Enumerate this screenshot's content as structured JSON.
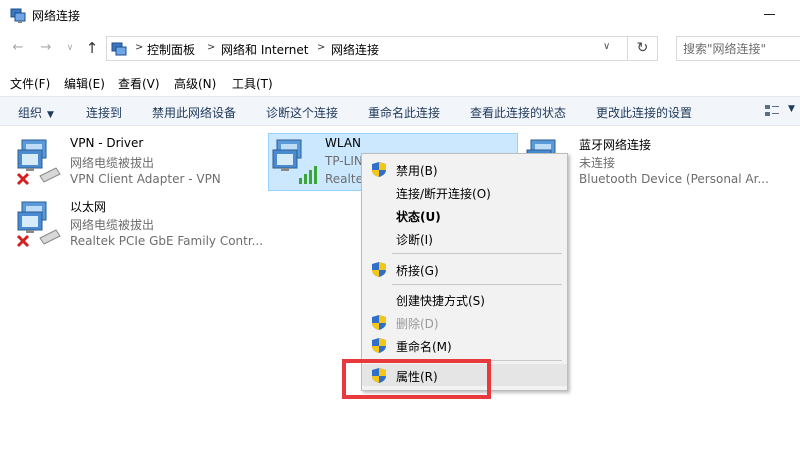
{
  "window": {
    "title": "网络连接"
  },
  "address": {
    "crumbs": [
      "控制面板",
      "网络和 Internet",
      "网络连接"
    ],
    "search_placeholder": "搜索\"网络连接\""
  },
  "menubar": {
    "items": [
      "文件(F)",
      "编辑(E)",
      "查看(V)",
      "高级(N)",
      "工具(T)"
    ]
  },
  "commandbar": {
    "organize": "组织",
    "items": [
      "连接到",
      "禁用此网络设备",
      "诊断这个连接",
      "重命名此连接",
      "查看此连接的状态",
      "更改此连接的设置"
    ]
  },
  "connections": [
    {
      "name": "VPN - Driver",
      "status": "网络电缆被拔出",
      "device": "VPN Client Adapter - VPN",
      "icon": "wired-disconnected"
    },
    {
      "name": "WLAN",
      "status": "TP-LIN",
      "device": "Realte",
      "icon": "wireless-connected"
    },
    {
      "name": "蓝牙网络连接",
      "status": "未连接",
      "device": "Bluetooth Device (Personal Ar...",
      "icon": "bluetooth"
    },
    {
      "name": "以太网",
      "status": "网络电缆被拔出",
      "device": "Realtek PCIe GbE Family Contr...",
      "icon": "wired-disconnected"
    }
  ],
  "context_menu": {
    "items": [
      {
        "label": "禁用(B)",
        "shield": true,
        "bold": false,
        "disabled": false
      },
      {
        "label": "连接/断开连接(O)",
        "shield": false,
        "bold": false,
        "disabled": false
      },
      {
        "label": "状态(U)",
        "shield": false,
        "bold": true,
        "disabled": false
      },
      {
        "label": "诊断(I)",
        "shield": false,
        "bold": false,
        "disabled": false
      },
      {
        "label": "桥接(G)",
        "shield": true,
        "bold": false,
        "disabled": false
      },
      {
        "label": "创建快捷方式(S)",
        "shield": false,
        "bold": false,
        "disabled": false
      },
      {
        "label": "删除(D)",
        "shield": true,
        "bold": false,
        "disabled": true
      },
      {
        "label": "重命名(M)",
        "shield": true,
        "bold": false,
        "disabled": false
      },
      {
        "label": "属性(R)",
        "shield": true,
        "bold": false,
        "disabled": false
      }
    ]
  },
  "colors": {
    "highlight": "#e8393c",
    "selection": "#cce8ff",
    "commandbar_bg": "#f2f5f9",
    "link_text": "#1e395b"
  }
}
